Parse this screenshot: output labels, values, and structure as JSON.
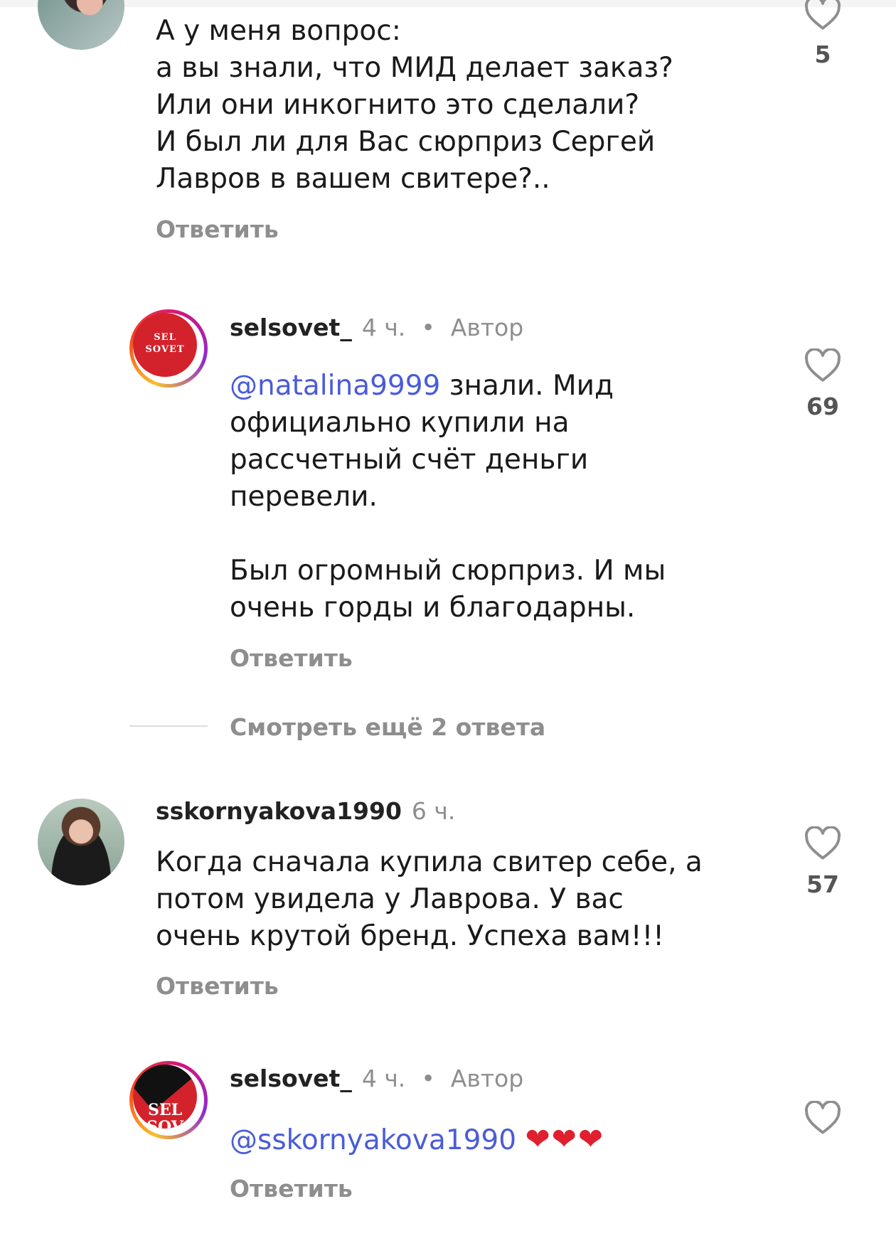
{
  "comments": [
    {
      "text": "А у меня вопрос:\nа вы знали, что МИД делает заказ?\nИли они инкогнито это сделали?\nИ был ли для Вас сюрприз Сергей\nЛавров в вашем свитере?..",
      "reply_label": "Ответить",
      "likes": "5"
    },
    {
      "username": "selsovet_",
      "time": "4 ч.",
      "badge": "Автор",
      "mention": "natalina9999",
      "text": " знали. Мид\nофициально купили на\nрассчетный счёт деньги\nперевели.\n\nБыл огромный сюрприз. И мы\nочень горды и благодарны.",
      "reply_label": "Ответить",
      "likes": "69",
      "logo_text": "SEL SOVET"
    },
    {
      "username": "sskornyakova1990",
      "time": "6 ч.",
      "text": "Когда сначала купила свитер себе, а\nпотом увидела у Лаврова. У вас\nочень крутой бренд. Успеха вам!!!",
      "reply_label": "Ответить",
      "likes": "57"
    },
    {
      "username": "selsovet_",
      "time": "4 ч.",
      "badge": "Автор",
      "mention": "sskornyakova1990",
      "text": "❤❤❤",
      "reply_label": "Ответить",
      "logo_text": "SEL SOV"
    }
  ],
  "more_replies": "Смотреть ещё 2 ответа",
  "colors": {
    "mention": "#4a5cd8",
    "muted": "#8e8e8e",
    "heart": "#e0202e"
  },
  "icons": {
    "like": "heart-outline-icon",
    "mention": "threads-at-icon"
  }
}
